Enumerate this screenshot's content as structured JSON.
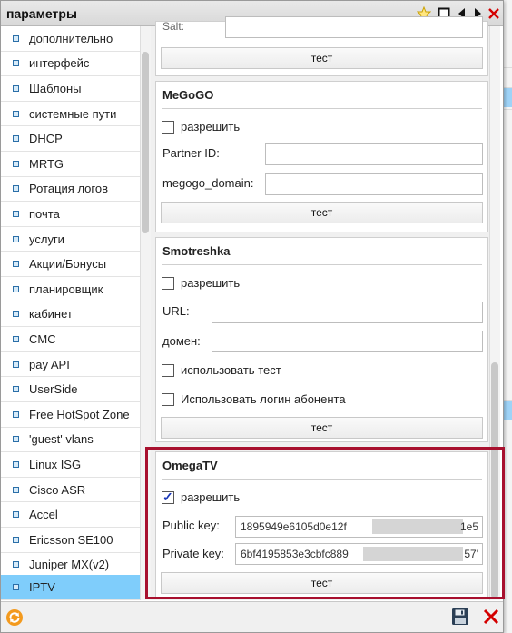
{
  "window": {
    "title": "параметры"
  },
  "titlebar_icons": [
    "star-icon",
    "maximize-icon",
    "arrow-left-icon",
    "arrow-right-icon",
    "close-icon"
  ],
  "sidebar": {
    "items": [
      {
        "label": "дополнительно"
      },
      {
        "label": "интерфейс"
      },
      {
        "label": "Шаблоны"
      },
      {
        "label": "системные пути"
      },
      {
        "label": "DHCP"
      },
      {
        "label": "MRTG"
      },
      {
        "label": "Ротация логов"
      },
      {
        "label": "почта"
      },
      {
        "label": "услуги"
      },
      {
        "label": "Акции/Бонусы"
      },
      {
        "label": "планировщик"
      },
      {
        "label": "кабинет"
      },
      {
        "label": "CMC"
      },
      {
        "label": "pay API"
      },
      {
        "label": "UserSide"
      },
      {
        "label": "Free HotSpot Zone"
      },
      {
        "label": "'guest' vlans"
      },
      {
        "label": "Linux ISG"
      },
      {
        "label": "Cisco ASR"
      },
      {
        "label": "Accel"
      },
      {
        "label": "Ericsson SE100"
      },
      {
        "label": "Juniper MX(v2)"
      },
      {
        "label": "IPTV"
      }
    ],
    "active_index": 22
  },
  "panels": {
    "top": {
      "label_cut": "Salt:",
      "button": "тест"
    },
    "megogo": {
      "title": "MeGoGO",
      "enable_label": "разрешить",
      "partner_id_label": "Partner ID:",
      "partner_id_value": "",
      "domain_label": "megogo_domain:",
      "domain_value": "",
      "button": "тест"
    },
    "smotreshka": {
      "title": "Smotreshka",
      "enable_label": "разрешить",
      "url_label": "URL:",
      "url_value": "",
      "domain_label": "домен:",
      "domain_value": "",
      "use_test_label": "использовать тест",
      "use_login_label": "Использовать логин абонента",
      "button": "тест"
    },
    "omegatv": {
      "title": "OmegaTV",
      "enable_label": "разрешить",
      "public_key_label": "Public key:",
      "public_key_value": "1895949e6105d0e12f",
      "public_key_tail": "1e5",
      "private_key_label": "Private key:",
      "private_key_value": "6bf4195853e3cbfc889",
      "private_key_tail": "57'",
      "button": "тест"
    }
  },
  "footer_icons": [
    "refresh-icon",
    "save-icon",
    "close-icon"
  ],
  "colors": {
    "highlight": "#a8102e",
    "active_item": "#7fcdfb",
    "close": "#d40000"
  }
}
